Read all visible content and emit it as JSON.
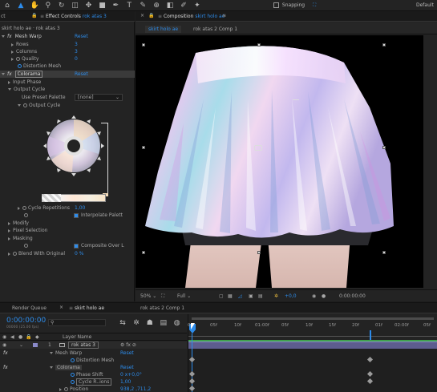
{
  "toolbar": {
    "snapping_label": "Snapping",
    "default_label": "Default"
  },
  "effect_controls": {
    "tab_prefix": "ct",
    "tab_label": "Effect Controls",
    "tab_layer": "rok atas 3",
    "breadcrumb": "skirt holo ae · rok atas 3",
    "mesh_warp": {
      "name": "Mesh Warp",
      "reset": "Reset",
      "rows_label": "Rows",
      "rows_value": "3",
      "columns_label": "Columns",
      "columns_value": "3",
      "quality_label": "Quality",
      "quality_value": "0",
      "distortion_label": "Distortion Mesh"
    },
    "colorama": {
      "name": "Colorama",
      "reset": "Reset",
      "input_phase": "Input Phase",
      "output_cycle": "Output Cycle",
      "preset_label": "Use Preset Palette",
      "preset_value": "[none]",
      "output_cycle_sub": "Output Cycle",
      "cycle_rep_label": "Cycle Repetitions",
      "cycle_rep_value": "1,00",
      "interpolate_label": "Interpolate Palett",
      "modify": "Modify",
      "pixel_selection": "Pixel Selection",
      "masking": "Masking",
      "composite_label": "Composite Over L",
      "blend_label": "Blend With Original",
      "blend_value": "0 %"
    }
  },
  "composition": {
    "tab_prefix": "Composition",
    "tab_name": "skirt holo ae",
    "subtab_active": "skirt holo ae",
    "subtab_other": "rok atas 2 Comp 1",
    "zoom": "50%",
    "resolution": "Full",
    "exposure": "+0,0",
    "timecode": "0:00:00:00"
  },
  "timeline": {
    "render_queue": "Render Queue",
    "tab_active": "skirt holo ae",
    "tab_other": "rok atas 2 Comp 1",
    "timecode": "0:00:00:00",
    "fps": "00000 (25.00 fps)",
    "col_header": "Layer Name",
    "ruler": [
      "0f",
      "05f",
      "10f",
      "01:00f",
      "05f",
      "10f",
      "15f",
      "20f",
      "01f",
      "02:00f",
      "05f"
    ],
    "layer": {
      "num": "1",
      "name": "rok atas 3"
    },
    "mesh_warp": "Mesh Warp",
    "mesh_reset": "Reset",
    "distortion": "Distortion Mesh",
    "colorama": "Colorama",
    "colorama_reset": "Reset",
    "phase_shift": "Phase Shift",
    "phase_value": "0 x+0,0°",
    "cycle_rep": "Cycle R..ions",
    "cycle_value": "1,00",
    "position": "Position",
    "position_value": "938,2 ,711,2"
  }
}
